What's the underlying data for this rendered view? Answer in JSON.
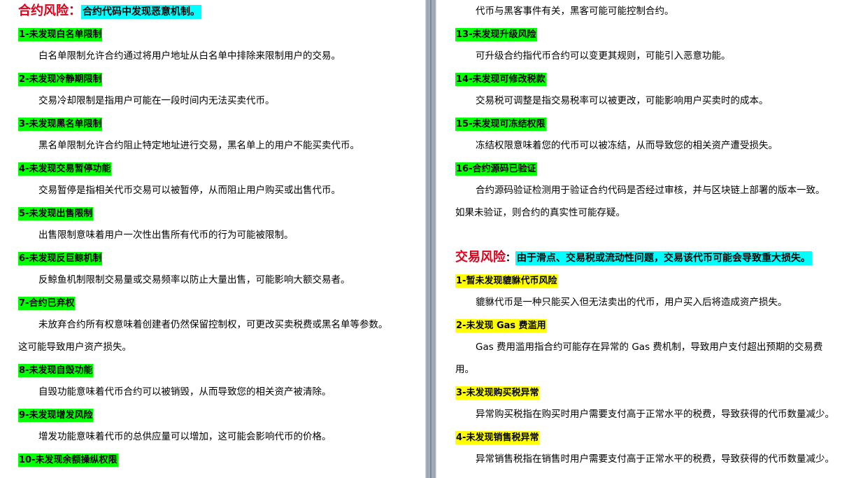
{
  "left": {
    "risk_label": "合约风险",
    "risk_colon": "：",
    "risk_summary": "合约代码中发现恶意机制。",
    "items": [
      {
        "header": "1-未发现白名单限制",
        "lines": [
          "白名单限制允许合约通过将用户地址从白名单中排除来限制用户的交易。"
        ]
      },
      {
        "header": "2-未发现冷静期限制",
        "lines": [
          "交易冷却限制是指用户可能在一段时间内无法买卖代币。"
        ]
      },
      {
        "header": "3-未发现黑名单限制",
        "lines": [
          "黑名单限制允许合约阻止特定地址进行交易，黑名单上的用户不能买卖代币。"
        ]
      },
      {
        "header": "4-未发现交易暂停功能",
        "lines": [
          "交易暂停是指相关代币交易可以被暂停，从而阻止用户购买或出售代币。"
        ]
      },
      {
        "header": "5-未发现出售限制",
        "lines": [
          "出售限制意味着用户一次性出售所有代币的行为可能被限制。"
        ]
      },
      {
        "header": "6-未发现反巨鲸机制",
        "lines": [
          "反鲸鱼机制限制交易量或交易频率以防止大量出售，可能影响大额交易者。"
        ]
      },
      {
        "header": "7-合约已弃权",
        "lines": [
          "未放弃合约所有权意味着创建者仍然保留控制权，可更改买卖税费或黑名单等参数。",
          "这可能导致用户资产损失。"
        ]
      },
      {
        "header": "8-未发现自毁功能",
        "lines": [
          "自毁功能意味着代币合约可以被销毁，从而导致您的相关资产被清除。"
        ]
      },
      {
        "header": "9-未发现增发风险",
        "lines": [
          "增发功能意味着代币的总供应量可以增加，这可能会影响代币的价格。"
        ]
      },
      {
        "header": "10-未发现余额操纵权限",
        "lines": []
      }
    ]
  },
  "right": {
    "top_line": "代币与黑客事件有关，黑客可能可能控制合约。",
    "items": [
      {
        "header": "13-未发现升级风险",
        "lines": [
          "可升级合约指代币合约可以变更其规则，可能引入恶意功能。"
        ]
      },
      {
        "header": "14-未发现可修改税款",
        "lines": [
          "交易税可调整是指交易税率可以被更改，可能影响用户买卖时的成本。"
        ]
      },
      {
        "header": "15-未发现可冻结权限",
        "lines": [
          "冻结权限意味着您的代币可以被冻结，从而导致您的相关资产遭受损失。"
        ]
      },
      {
        "header": "16-合约源码已验证",
        "lines": [
          "合约源码验证检测用于验证合约代码是否经过审核，并与区块链上部署的版本一致。",
          "如果未验证，则合约的真实性可能存疑。"
        ]
      }
    ],
    "risk_label": "交易风险",
    "risk_colon": "：",
    "risk_summary": "由于滑点、交易税或流动性问题，交易该代币可能会导致重大损失。",
    "trade_items": [
      {
        "header": "1-暂未发现貔貅代币风险",
        "lines": [
          "貔貅代币是一种只能买入但无法卖出的代币，用户买入后将造成资产损失。"
        ]
      },
      {
        "header": "2-未发现 Gas 费滥用",
        "lines": [
          "Gas 费用滥用指合约可能存在异常的 Gas 费机制，导致用户支付超出预期的交易费",
          "用。"
        ]
      },
      {
        "header": "3-未发现购买税异常",
        "lines": [
          "异常购买税指在购买时用户需要支付高于正常水平的税费，导致获得的代币数量减少。"
        ]
      },
      {
        "header": "4-未发现销售税异常",
        "lines": [
          "异常销售税指在销售时用户需要支付高于正常水平的税费，导致获得的代币数量减少。"
        ]
      }
    ]
  },
  "colors": {
    "risk_red": "#e0001b",
    "highlight_cyan": "#00ffff",
    "highlight_green": "#00ff00",
    "highlight_yellow": "#ffff00"
  }
}
